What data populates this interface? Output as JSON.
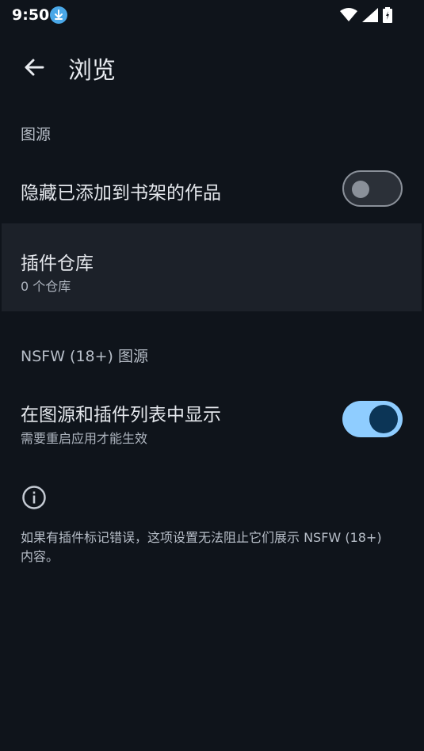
{
  "status_bar": {
    "time": "9:50",
    "icons": [
      "download-icon",
      "wifi-icon",
      "signal-icon",
      "battery-icon"
    ]
  },
  "app_bar": {
    "title": "浏览"
  },
  "sections": {
    "source_label": "图源",
    "hide_in_library": {
      "label": "隐藏已添加到书架的作品",
      "enabled": false
    },
    "extension_repos": {
      "title": "插件仓库",
      "subtitle": "0 个仓库"
    },
    "nsfw_label": "NSFW (18+) 图源",
    "show_nsfw": {
      "label": "在图源和插件列表中显示",
      "subtitle": "需要重启应用才能生效",
      "enabled": true
    },
    "note": "如果有插件标记错误，这项设置无法阻止它们展示 NSFW (18+) 内容。"
  },
  "colors": {
    "background": "#0f141b",
    "accent": "#8fcdff"
  }
}
